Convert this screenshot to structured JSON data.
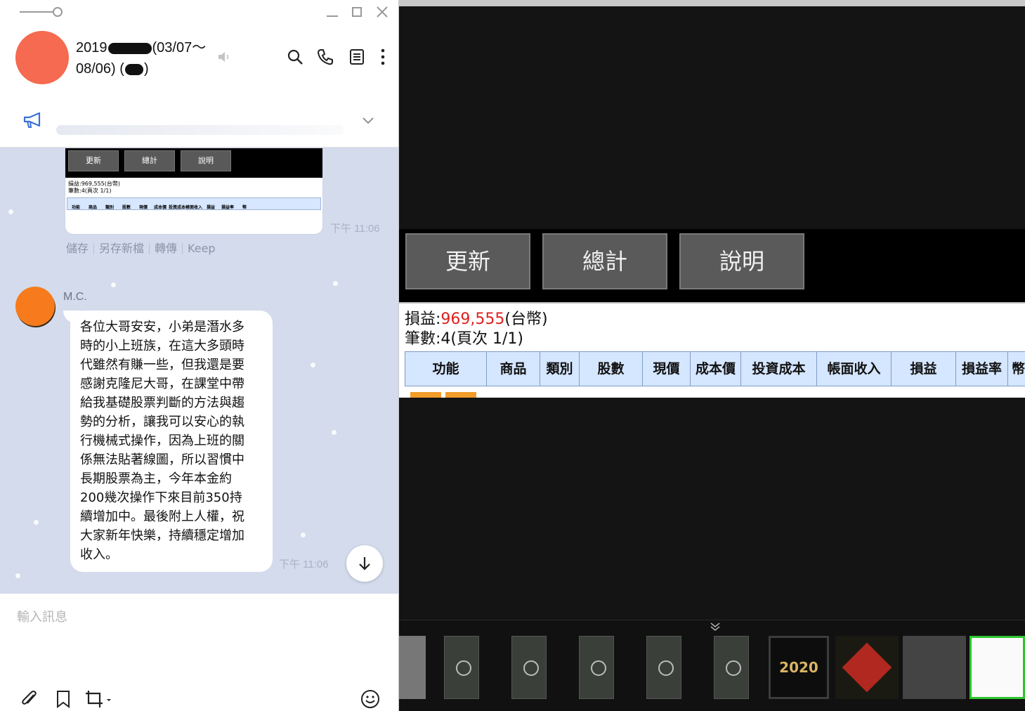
{
  "chat": {
    "title_line1_pre": "2019",
    "title_line1_post": "(03/07～",
    "title_line2_pre": "08/06) (",
    "title_line2_post": ")",
    "image_message": {
      "buttons": [
        "更新",
        "總計",
        "說明"
      ],
      "summary_line1": "損益:969,555(台幣)",
      "summary_line2": "筆數:4(頁次 1/1)",
      "headers": [
        "功能",
        "商品",
        "類別",
        "股數",
        "現價",
        "成本價",
        "投資成本",
        "帳面收入",
        "損益",
        "損益率",
        "幣"
      ],
      "time": "下午 11:06"
    },
    "actions": [
      "儲存",
      "另存新檔",
      "轉傳",
      "Keep"
    ],
    "sender_name": "M.C.",
    "message_text": "各位大哥安安，小弟是潛水多\n時的小上班族，在這大多頭時\n代雖然有賺一些，但我還是要\n感謝克隆尼大哥，在課堂中帶\n給我基礎股票判斷的方法與趨\n勢的分析，讓我可以安心的執\n行機械式操作，因為上班的關\n係無法貼著線圖，所以習慣中\n長期股票為主，今年本金約\n200幾次操作下來目前350持\n續增加中。最後附上人權，祝\n大家新年快樂，持續穩定增加\n收入。",
    "message_time": "下午 11:06",
    "composer_placeholder": "輸入訊息",
    "colors": {
      "chat_bg": "#d3dbec",
      "group_avatar": "#f56a50",
      "sender_avatar": "#f77b1d"
    }
  },
  "viewer": {
    "buttons": [
      "更新",
      "總計",
      "說明"
    ],
    "summary_label1": "損益:",
    "summary_value1": "969,555",
    "summary_suffix1": "(台幣)",
    "summary_line2": "筆數:4(頁次 1/1)",
    "headers": [
      "功能",
      "商品",
      "類別",
      "股數",
      "現價",
      "成本價",
      "投資成本",
      "帳面收入",
      "損益",
      "損益率",
      "幣"
    ],
    "ny_thumb_text": "2020",
    "colors": {
      "profit": "#e02020",
      "header_bg": "#d5e6ff",
      "selected_thumb": "#2dc52d"
    }
  },
  "icons": [
    "pin-icon",
    "minimize-icon",
    "maximize-icon",
    "close-icon",
    "mute-icon",
    "search-icon",
    "phone-icon",
    "notes-icon",
    "more-icon",
    "megaphone-icon",
    "chevron-down-icon",
    "arrow-down-icon",
    "attachment-icon",
    "bookmark-icon",
    "crop-icon",
    "emoji-icon",
    "double-chevron-down-icon"
  ]
}
